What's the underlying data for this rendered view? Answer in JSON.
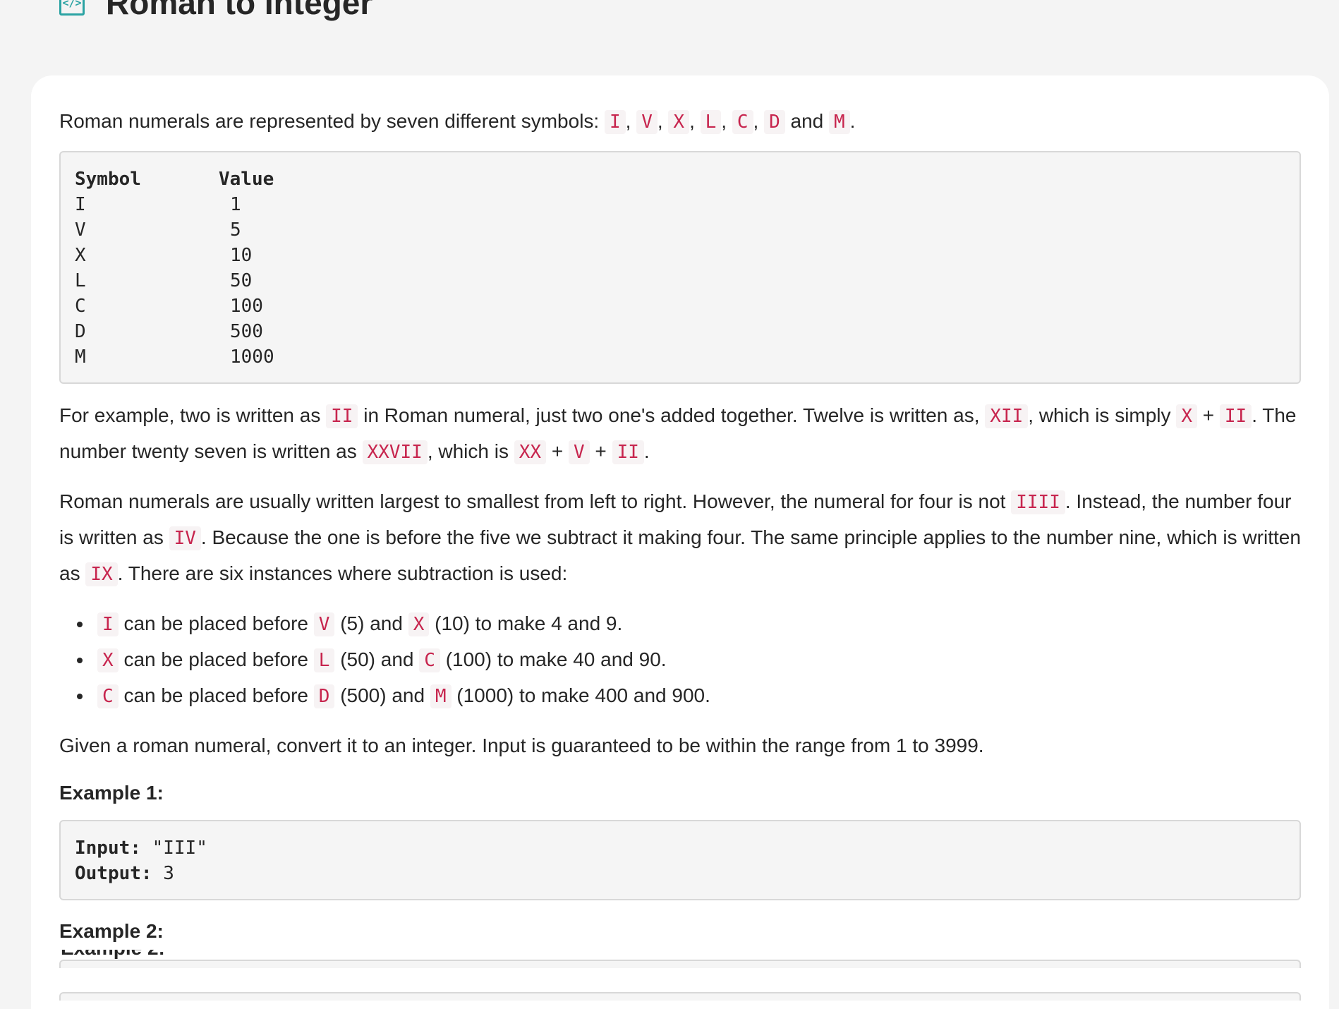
{
  "problem": {
    "title": "Roman to Integer",
    "icon": "code-icon"
  },
  "description": {
    "intro": {
      "before": "Roman numerals are represented by seven different symbols:",
      "symbols": [
        "I",
        "V",
        "X",
        "L",
        "C",
        "D",
        "M"
      ],
      "sep": ",",
      "and": "and",
      "end": "."
    },
    "table": {
      "header_symbol": "Symbol",
      "header_value": "Value",
      "rows": [
        {
          "symbol": "I",
          "value": "1"
        },
        {
          "symbol": "V",
          "value": "5"
        },
        {
          "symbol": "X",
          "value": "10"
        },
        {
          "symbol": "L",
          "value": "50"
        },
        {
          "symbol": "C",
          "value": "100"
        },
        {
          "symbol": "D",
          "value": "500"
        },
        {
          "symbol": "M",
          "value": "1000"
        }
      ]
    },
    "para1": {
      "t1": "For example, two is written as",
      "c1": "II",
      "t2": "in Roman numeral, just two one's added together. Twelve is written as,",
      "c2": "XII",
      "t3": ", which is simply",
      "c3": "X",
      "plus": "+",
      "c4": "II",
      "t4": ". The number twenty seven is written as",
      "c5": "XXVII",
      "t5": ", which is",
      "c6": "XX",
      "c7": "V",
      "c8": "II",
      "t6": "."
    },
    "para2": {
      "t1": "Roman numerals are usually written largest to smallest from left to right. However, the numeral for four is not",
      "c1": "IIII",
      "t2": ". Instead, the number four is written as",
      "c2": "IV",
      "t3": ". Because the one is before the five we subtract it making four. The same principle applies to the number nine, which is written as",
      "c3": "IX",
      "t4": ". There are six instances where subtraction is used:"
    },
    "rules": [
      {
        "a": "I",
        "t1": "can be placed before",
        "b": "V",
        "t2": "(5) and",
        "c": "X",
        "t3": "(10) to make 4 and 9."
      },
      {
        "a": "X",
        "t1": "can be placed before",
        "b": "L",
        "t2": "(50) and",
        "c": "C",
        "t3": "(100) to make 40 and 90."
      },
      {
        "a": "C",
        "t1": "can be placed before",
        "b": "D",
        "t2": "(500) and",
        "c": "M",
        "t3": "(1000) to make 400 and 900."
      }
    ],
    "task": "Given a roman numeral, convert it to an integer. Input is guaranteed to be within the range from 1 to 3999."
  },
  "examples": [
    {
      "heading": "Example 1:",
      "input_label": "Input:",
      "input": "\"III\"",
      "output_label": "Output:",
      "output": "3"
    },
    {
      "heading": "Example 2:"
    }
  ],
  "overlay_heading": "Example 2:"
}
